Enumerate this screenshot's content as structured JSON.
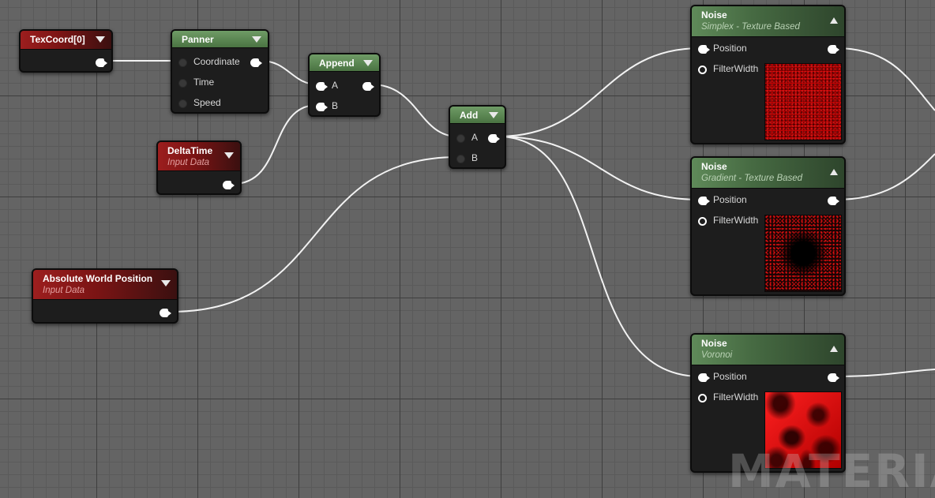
{
  "nodes": {
    "texcoord": {
      "title": "TexCoord[0]"
    },
    "panner": {
      "title": "Panner",
      "inputs": [
        "Coordinate",
        "Time",
        "Speed"
      ]
    },
    "append": {
      "title": "Append",
      "inputs": [
        "A",
        "B"
      ]
    },
    "deltatime": {
      "title": "DeltaTime",
      "subtitle": "Input Data"
    },
    "add": {
      "title": "Add",
      "inputs": [
        "A",
        "B"
      ]
    },
    "absworldpos": {
      "title": "Absolute World Position",
      "subtitle": "Input Data"
    },
    "noise_simplex": {
      "title": "Noise",
      "subtitle": "Simplex - Texture Based",
      "inputs": [
        "Position",
        "FilterWidth"
      ]
    },
    "noise_gradient": {
      "title": "Noise",
      "subtitle": "Gradient - Texture Based",
      "inputs": [
        "Position",
        "FilterWidth"
      ]
    },
    "noise_voronoi": {
      "title": "Noise",
      "subtitle": "Voronoi",
      "inputs": [
        "Position",
        "FilterWidth"
      ]
    }
  },
  "watermark": "MATERIAL",
  "colors": {
    "input_header": "#9c1e1e",
    "function_header": "#5f8a59",
    "wire": "#ffffff",
    "grid": "#646464"
  }
}
